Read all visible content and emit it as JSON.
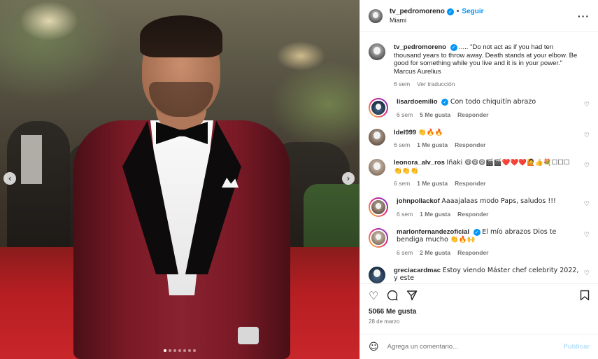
{
  "post": {
    "author": "tv_pedromoreno",
    "follow_label": "Seguir",
    "location": "Miami",
    "separator": "•",
    "more_icon": "more-options-icon",
    "more_glyph": "···",
    "caption": {
      "username": "tv_pedromoreno",
      "text": "..... \"Do not act as if you had ten thousand years to throw away. Death stands at your elbow. Be good for something while you live and it is in your power.\"",
      "attribution": "Marcus Aurelius",
      "time": "6 sem",
      "translate": "Ver traducción"
    },
    "likes": "5066 Me gusta",
    "date": "28 de marzo"
  },
  "carousel": {
    "slides": 7,
    "active_index": 0,
    "prev_glyph": "‹",
    "next_glyph": "›"
  },
  "comments": [
    {
      "username": "lisardoemilio",
      "verified": true,
      "text": "Con todo chiquitín abrazo",
      "time": "6 sem",
      "likes": "5 Me gusta",
      "reply": "Responder"
    },
    {
      "username": "ldel999",
      "verified": false,
      "text": "👏🔥🔥",
      "time": "6 sem",
      "likes": "1 Me gusta",
      "reply": "Responder"
    },
    {
      "username": "leonora_alv_ros",
      "verified": false,
      "text": "Iñaki 😄😄😄🎬🎬❤️❤️❤️🙋👍💐☐☐☐ 👏👏👏",
      "time": "6 sem",
      "likes": "1 Me gusta",
      "reply": "Responder"
    },
    {
      "username": "johnpollackof",
      "verified": false,
      "text": "Aaaajalaas modo Paps, saludos !!!",
      "time": "6 sem",
      "likes": "1 Me gusta",
      "reply": "Responder"
    },
    {
      "username": "marlonfernandezoficial",
      "verified": true,
      "text": "El mío abrazos Dios te bendiga mucho 👏🔥🙌",
      "time": "6 sem",
      "likes": "2 Me gusta",
      "reply": "Responder"
    },
    {
      "username": "greciacardmac",
      "verified": false,
      "text": "Estoy viendo Máster chef celebrity 2022, y este",
      "time": "",
      "likes": "",
      "reply": ""
    }
  ],
  "actions": {
    "like_icon": "heart-icon",
    "comment_icon": "comment-icon",
    "share_icon": "share-icon",
    "save_icon": "bookmark-icon"
  },
  "composer": {
    "placeholder": "Agrega un comentario...",
    "post_label": "Publicar",
    "emoji_icon": "emoji-icon"
  },
  "colors": {
    "link_blue": "#0095f6",
    "muted": "#737373",
    "post_disabled": "#b2dffc"
  }
}
